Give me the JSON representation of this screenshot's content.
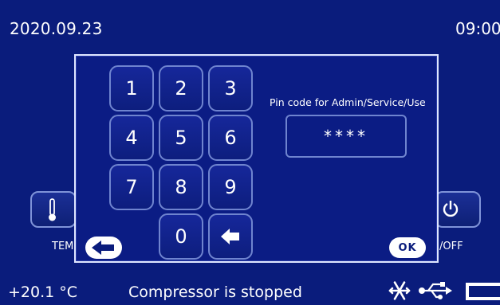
{
  "header": {
    "date": "2020.09.23",
    "time": "09:00"
  },
  "background_buttons": {
    "temp_label": "TEM",
    "power_label": "/OFF",
    "temp_icon": "thermometer-icon",
    "power_icon": "power-icon"
  },
  "status_bar": {
    "temperature": "+20.1 °C",
    "compressor_status": "Compressor is stopped",
    "icons": [
      "snowflake-icon",
      "usb-icon",
      "battery-icon"
    ]
  },
  "pin_dialog": {
    "keys": [
      "1",
      "2",
      "3",
      "4",
      "5",
      "6",
      "7",
      "8",
      "9",
      "0"
    ],
    "backspace_icon": "backspace-arrow-icon",
    "label": "Pin code for Admin/Service/Use",
    "value": "****",
    "back_icon": "back-arrow-icon",
    "ok_label": "OK"
  },
  "colors": {
    "background": "#0a1c7c",
    "key_border": "#6f84cf",
    "dialog_border": "#dfe6ff"
  }
}
